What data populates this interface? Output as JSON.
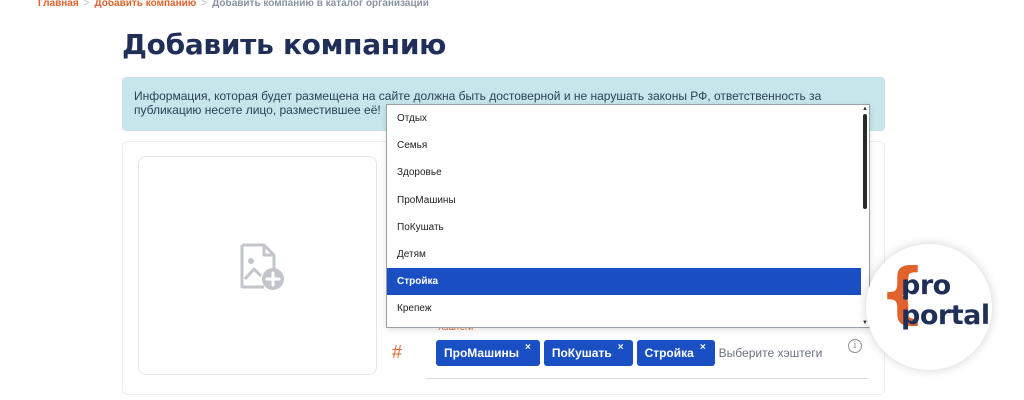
{
  "breadcrumb": {
    "items": [
      "Главная",
      "Добавить компанию",
      "Добавить компанию в каталог организаций"
    ]
  },
  "page": {
    "title": "Добавить компанию",
    "info": "Информация, которая будет размещена на сайте должна быть достоверной и не нарушать законы РФ, ответственность за публикацию несете лицо, разместившее её!"
  },
  "hashtags": {
    "label": "Хэштеги",
    "hash_symbol": "#",
    "tags": [
      {
        "label": "ПроМашины",
        "remove": "×"
      },
      {
        "label": "ПоКушать",
        "remove": "×"
      },
      {
        "label": "Стройка",
        "remove": "×"
      }
    ],
    "placeholder": "Выберите хэштеги",
    "info_symbol": "i"
  },
  "dropdown": {
    "options": [
      "Отдых",
      "Семья",
      "Здоровье",
      "ПроМашины",
      "ПоКушать",
      "Детям",
      "Стройка",
      "Крепеж"
    ],
    "selected": "Стройка",
    "scroll_up": "▲",
    "scroll_down": "▼"
  },
  "logo": {
    "brace": "{",
    "line1": "pro",
    "line2": "portal"
  },
  "colors": {
    "accent": "#e2622e",
    "primary": "#1a4fc3",
    "title": "#1f2f57",
    "banner": "#c6e6ec"
  }
}
